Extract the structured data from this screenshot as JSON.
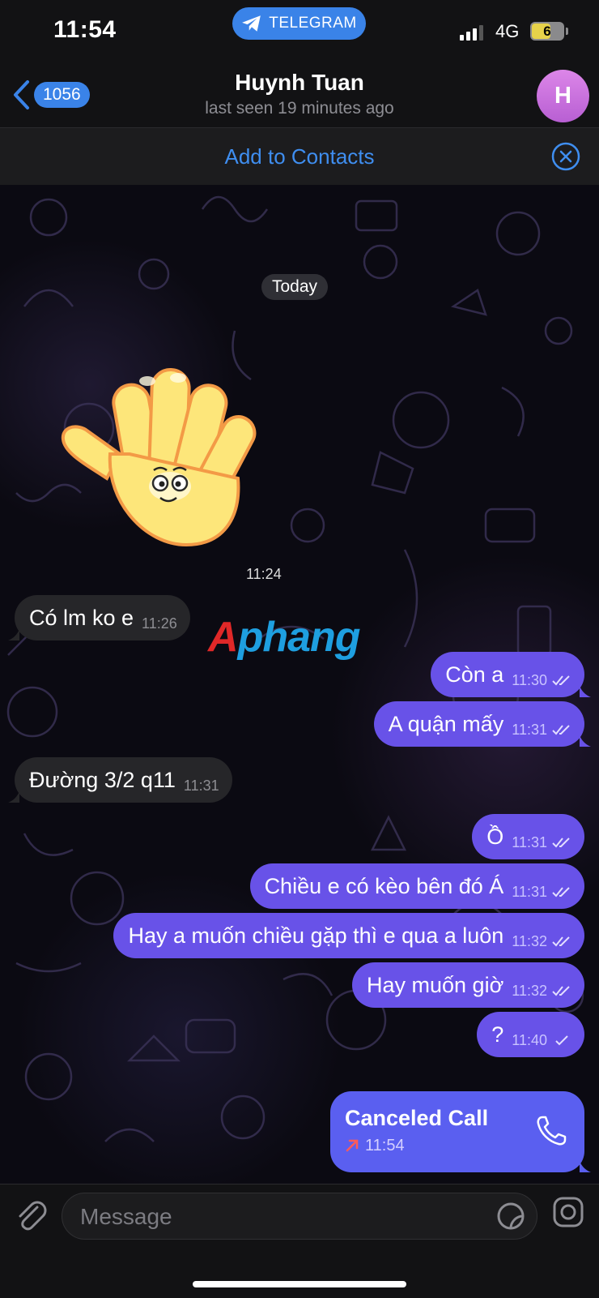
{
  "status_bar": {
    "time": "11:54",
    "app_pill": "TELEGRAM",
    "network": "4G",
    "battery": "6",
    "battery_level": 0.6
  },
  "header": {
    "back_count": "1056",
    "title": "Huynh Tuan",
    "subtitle": "last seen 19 minutes ago",
    "avatar_letter": "H",
    "avatar_color": "#c873de"
  },
  "contacts_bar": {
    "link": "Add to Contacts"
  },
  "chat": {
    "date_chip": "Today",
    "sticker_time": "11:24",
    "watermark": {
      "first": "A",
      "rest": "phang"
    },
    "messages": [
      {
        "dir": "in",
        "text": "Có lm ko e",
        "time": "11:26"
      },
      {
        "dir": "out",
        "text": "Còn a",
        "time": "11:30",
        "status": "read"
      },
      {
        "dir": "out",
        "text": "A quận mấy",
        "time": "11:31",
        "status": "read"
      },
      {
        "dir": "in",
        "text": "Đường 3/2 q11",
        "time": "11:31"
      },
      {
        "dir": "out",
        "text": "Ồ",
        "time": "11:31",
        "status": "read"
      },
      {
        "dir": "out",
        "text": "Chiều e có kèo bên đó Á",
        "time": "11:31",
        "status": "read"
      },
      {
        "dir": "out",
        "text": "Hay a muốn chiều gặp thì e qua a luôn",
        "time": "11:32",
        "status": "read"
      },
      {
        "dir": "out",
        "text": "Hay muốn giờ",
        "time": "11:32",
        "status": "read"
      },
      {
        "dir": "out",
        "text": "?",
        "time": "11:40",
        "status": "sent"
      }
    ],
    "call": {
      "title": "Canceled Call",
      "time": "11:54",
      "icon": "phone-icon"
    }
  },
  "input_bar": {
    "placeholder": "Message",
    "icons": [
      "paperclip-icon",
      "sticker-icon",
      "camera-icon"
    ]
  },
  "colors": {
    "accent": "#3a83e8",
    "outgoing_bubble": "#6852e8",
    "incoming_bubble": "#262629",
    "link": "#3f8ef0"
  }
}
